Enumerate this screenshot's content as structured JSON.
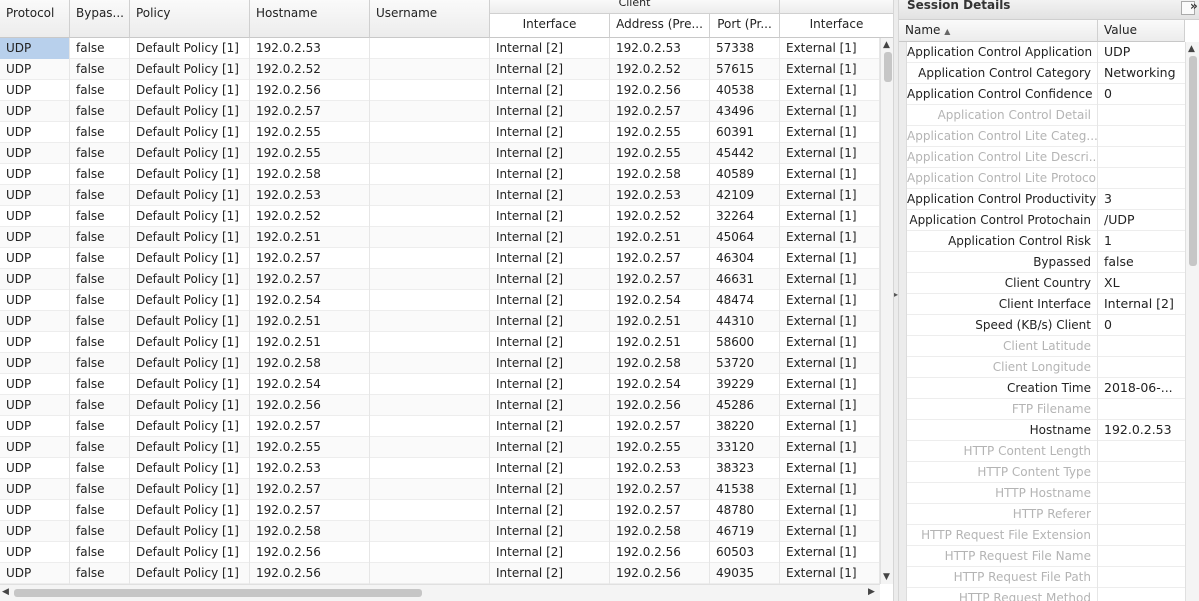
{
  "grid": {
    "client_group_label": "Client",
    "columns": [
      {
        "key": "protocol",
        "label": "Protocol"
      },
      {
        "key": "bypassed",
        "label": "Bypas..."
      },
      {
        "key": "policy",
        "label": "Policy"
      },
      {
        "key": "hostname",
        "label": "Hostname"
      },
      {
        "key": "username",
        "label": "Username"
      },
      {
        "key": "c_interface",
        "label": "Interface"
      },
      {
        "key": "c_address",
        "label": "Address (Pre..."
      },
      {
        "key": "c_port",
        "label": "Port (Pr..."
      },
      {
        "key": "s_interface",
        "label": "Interface"
      }
    ],
    "rows": [
      [
        "UDP",
        "false",
        "Default Policy [1]",
        "192.0.2.53",
        "",
        "Internal [2]",
        "192.0.2.53",
        "57338",
        "External [1]"
      ],
      [
        "UDP",
        "false",
        "Default Policy [1]",
        "192.0.2.52",
        "",
        "Internal [2]",
        "192.0.2.52",
        "57615",
        "External [1]"
      ],
      [
        "UDP",
        "false",
        "Default Policy [1]",
        "192.0.2.56",
        "",
        "Internal [2]",
        "192.0.2.56",
        "40538",
        "External [1]"
      ],
      [
        "UDP",
        "false",
        "Default Policy [1]",
        "192.0.2.57",
        "",
        "Internal [2]",
        "192.0.2.57",
        "43496",
        "External [1]"
      ],
      [
        "UDP",
        "false",
        "Default Policy [1]",
        "192.0.2.55",
        "",
        "Internal [2]",
        "192.0.2.55",
        "60391",
        "External [1]"
      ],
      [
        "UDP",
        "false",
        "Default Policy [1]",
        "192.0.2.55",
        "",
        "Internal [2]",
        "192.0.2.55",
        "45442",
        "External [1]"
      ],
      [
        "UDP",
        "false",
        "Default Policy [1]",
        "192.0.2.58",
        "",
        "Internal [2]",
        "192.0.2.58",
        "40589",
        "External [1]"
      ],
      [
        "UDP",
        "false",
        "Default Policy [1]",
        "192.0.2.53",
        "",
        "Internal [2]",
        "192.0.2.53",
        "42109",
        "External [1]"
      ],
      [
        "UDP",
        "false",
        "Default Policy [1]",
        "192.0.2.52",
        "",
        "Internal [2]",
        "192.0.2.52",
        "32264",
        "External [1]"
      ],
      [
        "UDP",
        "false",
        "Default Policy [1]",
        "192.0.2.51",
        "",
        "Internal [2]",
        "192.0.2.51",
        "45064",
        "External [1]"
      ],
      [
        "UDP",
        "false",
        "Default Policy [1]",
        "192.0.2.57",
        "",
        "Internal [2]",
        "192.0.2.57",
        "46304",
        "External [1]"
      ],
      [
        "UDP",
        "false",
        "Default Policy [1]",
        "192.0.2.57",
        "",
        "Internal [2]",
        "192.0.2.57",
        "46631",
        "External [1]"
      ],
      [
        "UDP",
        "false",
        "Default Policy [1]",
        "192.0.2.54",
        "",
        "Internal [2]",
        "192.0.2.54",
        "48474",
        "External [1]"
      ],
      [
        "UDP",
        "false",
        "Default Policy [1]",
        "192.0.2.51",
        "",
        "Internal [2]",
        "192.0.2.51",
        "44310",
        "External [1]"
      ],
      [
        "UDP",
        "false",
        "Default Policy [1]",
        "192.0.2.51",
        "",
        "Internal [2]",
        "192.0.2.51",
        "58600",
        "External [1]"
      ],
      [
        "UDP",
        "false",
        "Default Policy [1]",
        "192.0.2.58",
        "",
        "Internal [2]",
        "192.0.2.58",
        "53720",
        "External [1]"
      ],
      [
        "UDP",
        "false",
        "Default Policy [1]",
        "192.0.2.54",
        "",
        "Internal [2]",
        "192.0.2.54",
        "39229",
        "External [1]"
      ],
      [
        "UDP",
        "false",
        "Default Policy [1]",
        "192.0.2.56",
        "",
        "Internal [2]",
        "192.0.2.56",
        "45286",
        "External [1]"
      ],
      [
        "UDP",
        "false",
        "Default Policy [1]",
        "192.0.2.57",
        "",
        "Internal [2]",
        "192.0.2.57",
        "38220",
        "External [1]"
      ],
      [
        "UDP",
        "false",
        "Default Policy [1]",
        "192.0.2.55",
        "",
        "Internal [2]",
        "192.0.2.55",
        "33120",
        "External [1]"
      ],
      [
        "UDP",
        "false",
        "Default Policy [1]",
        "192.0.2.53",
        "",
        "Internal [2]",
        "192.0.2.53",
        "38323",
        "External [1]"
      ],
      [
        "UDP",
        "false",
        "Default Policy [1]",
        "192.0.2.57",
        "",
        "Internal [2]",
        "192.0.2.57",
        "41538",
        "External [1]"
      ],
      [
        "UDP",
        "false",
        "Default Policy [1]",
        "192.0.2.57",
        "",
        "Internal [2]",
        "192.0.2.57",
        "48780",
        "External [1]"
      ],
      [
        "UDP",
        "false",
        "Default Policy [1]",
        "192.0.2.58",
        "",
        "Internal [2]",
        "192.0.2.58",
        "46719",
        "External [1]"
      ],
      [
        "UDP",
        "false",
        "Default Policy [1]",
        "192.0.2.56",
        "",
        "Internal [2]",
        "192.0.2.56",
        "60503",
        "External [1]"
      ],
      [
        "UDP",
        "false",
        "Default Policy [1]",
        "192.0.2.56",
        "",
        "Internal [2]",
        "192.0.2.56",
        "49035",
        "External [1]"
      ]
    ],
    "selected_cell": {
      "row": 0,
      "col": 0
    },
    "selection_color": "#b8d0ec"
  },
  "panel": {
    "title": "Session Details",
    "collapse_icon": "double-chevron-right-icon",
    "name_header": "Name",
    "sort_icon": "sort-ascending-icon",
    "value_header": "Value",
    "properties": [
      {
        "name": "Application Control Application",
        "value": "UDP",
        "dim": false
      },
      {
        "name": "Application Control Category",
        "value": "Networking",
        "dim": false
      },
      {
        "name": "Application Control Confidence",
        "value": "0",
        "dim": false
      },
      {
        "name": "Application Control Detail",
        "value": "",
        "dim": true
      },
      {
        "name": "Application Control Lite Categ...",
        "value": "",
        "dim": true
      },
      {
        "name": "Application Control Lite Descri...",
        "value": "",
        "dim": true
      },
      {
        "name": "Application Control Lite Protocol",
        "value": "",
        "dim": true
      },
      {
        "name": "Application Control Productivity",
        "value": "3",
        "dim": false
      },
      {
        "name": "Application Control Protochain",
        "value": "/UDP",
        "dim": false
      },
      {
        "name": "Application Control Risk",
        "value": "1",
        "dim": false
      },
      {
        "name": "Bypassed",
        "value": "false",
        "dim": false
      },
      {
        "name": "Client Country",
        "value": "XL",
        "dim": false
      },
      {
        "name": "Client Interface",
        "value": "Internal [2]",
        "dim": false
      },
      {
        "name": "Speed (KB/s) Client",
        "value": "0",
        "dim": false
      },
      {
        "name": "Client Latitude",
        "value": "",
        "dim": true
      },
      {
        "name": "Client Longitude",
        "value": "",
        "dim": true
      },
      {
        "name": "Creation Time",
        "value": "2018-06-...",
        "dim": false
      },
      {
        "name": "FTP Filename",
        "value": "",
        "dim": true
      },
      {
        "name": "Hostname",
        "value": "192.0.2.53",
        "dim": false
      },
      {
        "name": "HTTP Content Length",
        "value": "",
        "dim": true
      },
      {
        "name": "HTTP Content Type",
        "value": "",
        "dim": true
      },
      {
        "name": "HTTP Hostname",
        "value": "",
        "dim": true
      },
      {
        "name": "HTTP Referer",
        "value": "",
        "dim": true
      },
      {
        "name": "HTTP Request File Extension",
        "value": "",
        "dim": true
      },
      {
        "name": "HTTP Request File Name",
        "value": "",
        "dim": true
      },
      {
        "name": "HTTP Request File Path",
        "value": "",
        "dim": true
      },
      {
        "name": "HTTP Request Method",
        "value": "",
        "dim": true
      }
    ]
  }
}
